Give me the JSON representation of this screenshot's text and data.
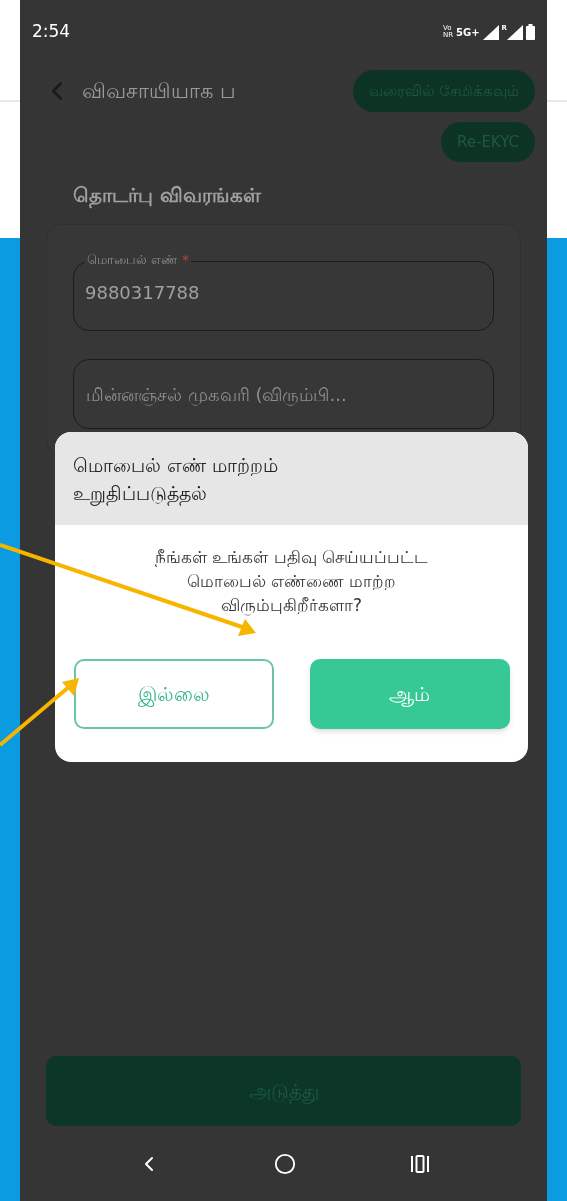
{
  "status_bar": {
    "time": "2:54",
    "vo_label": "Vo",
    "nr_label": "NR",
    "network": "5G+",
    "roaming": "R"
  },
  "header": {
    "title": "விவசாயியாக ப",
    "save_draft_button": "வரைவில் சேமிக்கவும்",
    "re_ekyc_button": "Re-EKYC"
  },
  "section_title": "தொடர்பு விவரங்கள்",
  "fields": [
    {
      "label": "மொபைல் எண்",
      "required_mark": "*",
      "value": "9880317788"
    },
    {
      "placeholder": "மின்னஞ்சல் முகவரி (விரும்பி..."
    }
  ],
  "dialog": {
    "title": "மொபைல் எண் மாற்றம் உறுதிப்படுத்தல்",
    "message": "நீங்கள் உங்கள் பதிவு செய்யப்பட்ட மொபைல் எண்ணை மாற்ற விரும்புகிறீர்களா?",
    "buttons": [
      {
        "label": "இல்லை",
        "kind": "outline"
      },
      {
        "label": "ஆம்",
        "kind": "filled"
      }
    ]
  },
  "next_button": "அடுத்து"
}
